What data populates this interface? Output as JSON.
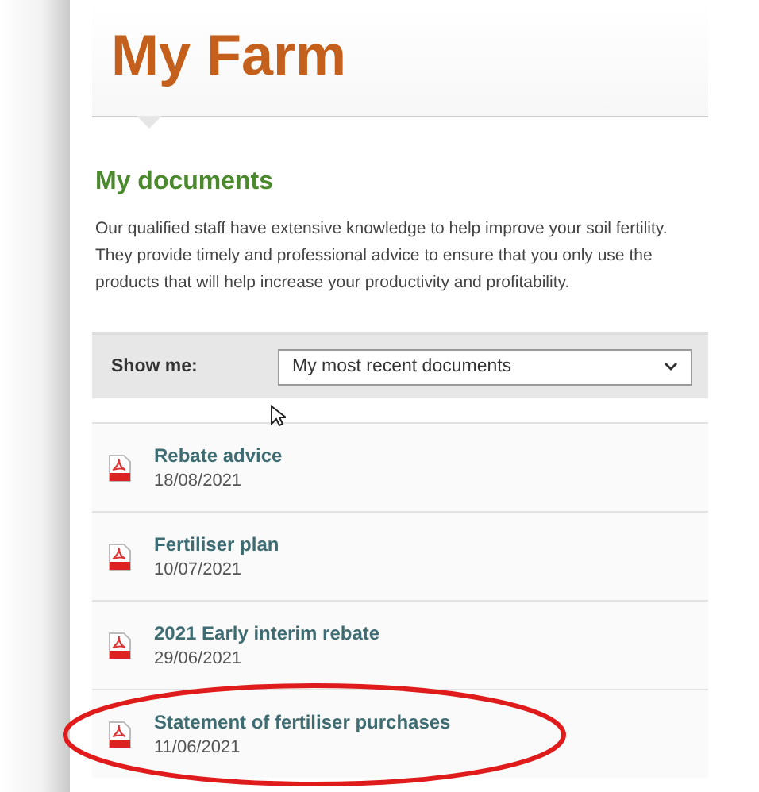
{
  "page_title": "My Farm",
  "section": {
    "title": "My documents",
    "description": "Our qualified staff have extensive knowledge to help improve your soil fertility. They provide timely and professional advice to ensure that you only use the products that will help increase your productivity and profitability."
  },
  "filter": {
    "label": "Show me:",
    "value": "My most recent documents"
  },
  "documents": [
    {
      "title": "Rebate advice",
      "date": "18/08/2021",
      "highlighted": false
    },
    {
      "title": "Fertiliser plan",
      "date": "10/07/2021",
      "highlighted": false
    },
    {
      "title": "2021 Early interim rebate",
      "date": "29/06/2021",
      "highlighted": false
    },
    {
      "title": "Statement of fertiliser purchases",
      "date": "11/06/2021",
      "highlighted": true
    }
  ]
}
